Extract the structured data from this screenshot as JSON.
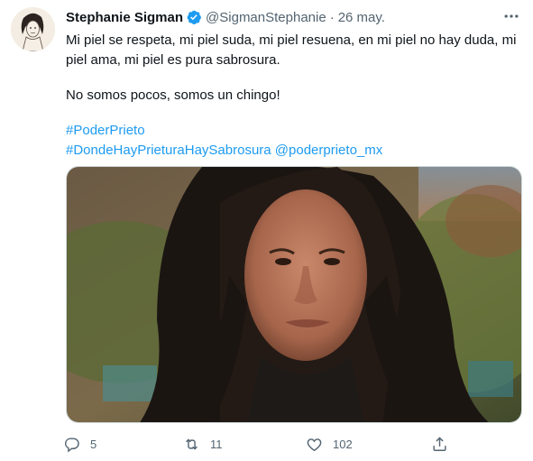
{
  "tweet": {
    "author_name": "Stephanie Sigman",
    "handle": "@SigmanStephanie",
    "separator": "·",
    "date": "26 may.",
    "text_line1": "Mi piel se respeta, mi piel suda, mi piel resuena, en mi piel no hay duda, mi piel ama, mi piel es pura sabrosura.",
    "text_line2": "No somos pocos, somos un chingo!",
    "hashtag1": "#PoderPrieto",
    "hashtag2": "#DondeHayPrieturaHaySabrosura",
    "mention": "@poderprieto_mx"
  },
  "actions": {
    "reply_count": "5",
    "retweet_count": "11",
    "like_count": "102"
  },
  "icons": {
    "verified": "verified-badge-icon",
    "more": "more-options-icon",
    "reply": "reply-icon",
    "retweet": "retweet-icon",
    "like": "heart-icon",
    "share": "share-icon"
  },
  "colors": {
    "link": "#1d9bf0",
    "secondary_text": "#536471",
    "primary_text": "#0f1419"
  }
}
